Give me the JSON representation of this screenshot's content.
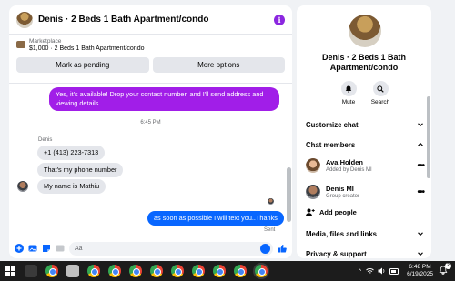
{
  "chat": {
    "title": "Denis · 2 Beds 1 Bath Apartment/condo",
    "info_symbol": "i",
    "marketplace": {
      "label": "Marketplace",
      "item": "$1,000 · 2 Beds 1 Bath Apartment/condo",
      "pending_button": "Mark as pending",
      "more_button": "More options"
    },
    "messages": {
      "out_1": "Yes, it's available! Drop your contact number, and I'll send address and viewing details",
      "timestamp": "6:45 PM",
      "sender": "Denis",
      "in_1": "+1 (413) 223-7313",
      "in_2": "That's my phone number",
      "in_3": "My name is Mathiu",
      "out_2": "as soon as possible I will text you..Thanks",
      "status": "Sent"
    },
    "composer": {
      "placeholder": "Aa"
    }
  },
  "info": {
    "title": "Denis · 2 Beds 1 Bath Apartment/condo",
    "mute_label": "Mute",
    "search_label": "Search",
    "customize_chat": "Customize chat",
    "chat_members": "Chat members",
    "members": [
      {
        "name": "Ava Holden",
        "subtitle": "Added by Denis MI"
      },
      {
        "name": "Denis MI",
        "subtitle": "Group creator"
      }
    ],
    "more_symbol": "•••",
    "add_people": "Add people",
    "media_files_links": "Media, files and links",
    "privacy_support": "Privacy & support"
  },
  "taskbar": {
    "time": "6:48 PM",
    "date": "6/19/2025",
    "notification_count": "2"
  },
  "colors": {
    "accent_purple": "#a11ee8",
    "messenger_blue": "#0866ff"
  }
}
